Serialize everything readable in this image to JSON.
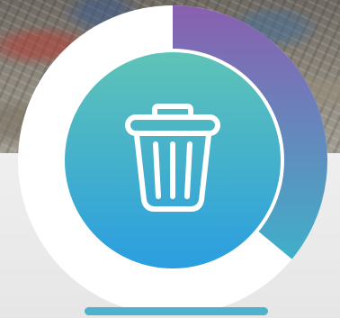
{
  "colors": {
    "ring_track": "#ffffff",
    "progress_start": "#8a5fb0",
    "progress_end": "#3fb0c9",
    "inner_top": "#5fc3b7",
    "inner_bottom": "#2a9ee0",
    "icon_stroke": "#ffffff",
    "underline": "#4fb2cc"
  },
  "progress": {
    "fraction": 0.36
  },
  "icon": {
    "name": "trash-bin-icon"
  },
  "background": {
    "description_visible": false
  }
}
